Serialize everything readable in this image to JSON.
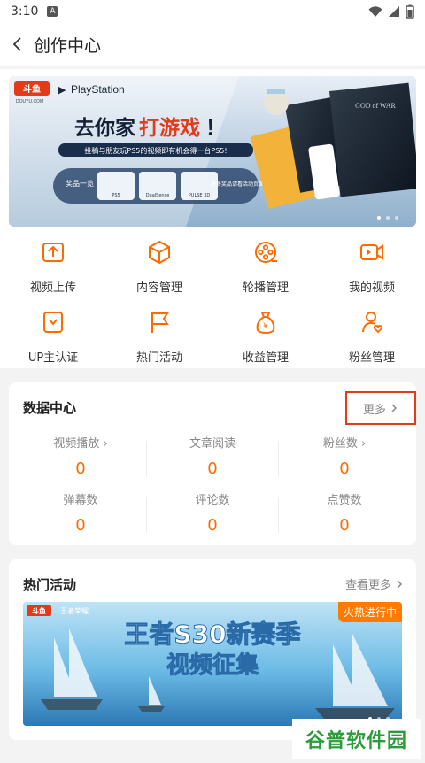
{
  "status_bar": {
    "time": "3:10",
    "badge": "A"
  },
  "header": {
    "title": "创作中心"
  },
  "banner": {
    "brand": "斗鱼",
    "brand_sub": "DOUYU.COM",
    "partner": "PlayStation",
    "headline_pre": "去你家",
    "headline_hl": "打游戏",
    "headline_post": "！",
    "subline": "投稿与朋友玩PS5的视频即有机会得一台PS5!",
    "prize_label": "奖品一览",
    "prizes": [
      "PS5",
      "DualSense",
      "PULSE 3D"
    ],
    "more_prizes": "更多奖品请看活动页面"
  },
  "tools": [
    {
      "label": "视频上传",
      "icon": "upload-icon"
    },
    {
      "label": "内容管理",
      "icon": "box-icon"
    },
    {
      "label": "轮播管理",
      "icon": "reel-icon"
    },
    {
      "label": "我的视频",
      "icon": "video-icon"
    },
    {
      "label": "UP主认证",
      "icon": "certificate-icon"
    },
    {
      "label": "热门活动",
      "icon": "flag-icon"
    },
    {
      "label": "收益管理",
      "icon": "money-bag-icon"
    },
    {
      "label": "粉丝管理",
      "icon": "fan-icon"
    }
  ],
  "data_center": {
    "title": "数据中心",
    "more": "更多",
    "stats": [
      {
        "label": "视频播放",
        "value": "0",
        "has_arrow": true
      },
      {
        "label": "文章阅读",
        "value": "0",
        "has_arrow": false
      },
      {
        "label": "粉丝数",
        "value": "0",
        "has_arrow": true
      },
      {
        "label": "弹幕数",
        "value": "0",
        "has_arrow": false
      },
      {
        "label": "评论数",
        "value": "0",
        "has_arrow": false
      },
      {
        "label": "点赞数",
        "value": "0",
        "has_arrow": false
      }
    ]
  },
  "hot_activity": {
    "title": "热门活动",
    "more": "查看更多",
    "badge": "火热进行中",
    "banner_line1": "王者S30新赛季",
    "banner_line2": "视频征集",
    "logos": [
      "斗鱼",
      "王者荣耀"
    ]
  },
  "watermark": "谷普软件园",
  "colors": {
    "accent": "#ff6a00",
    "highlight_border": "#e23b1a",
    "watermark": "#2a9d3a"
  }
}
